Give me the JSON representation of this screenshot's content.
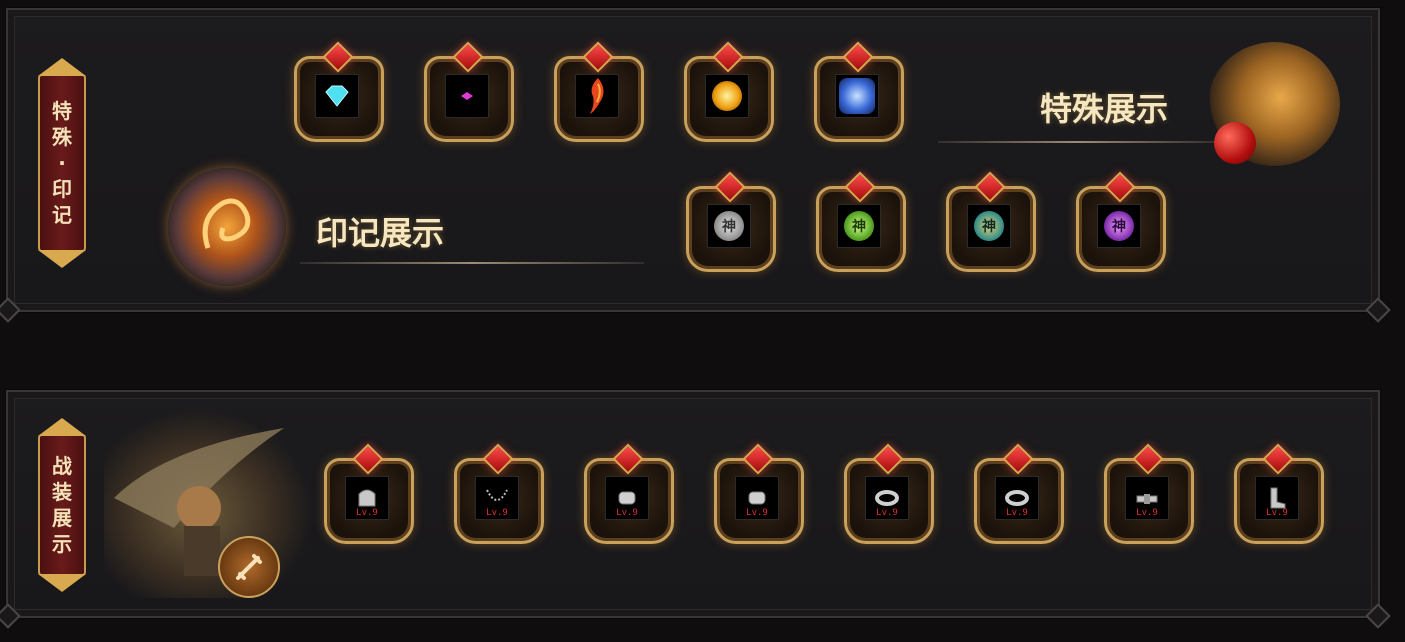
{
  "top_panel": {
    "badge_chars": [
      "特",
      "殊",
      "·",
      "印",
      "记"
    ],
    "special_title": "特殊展示",
    "seal_title": "印记展示",
    "special_items": [
      {
        "icon": "diamond-icon"
      },
      {
        "icon": "pink-gem-icon"
      },
      {
        "icon": "flame-feather-icon"
      },
      {
        "icon": "golden-orb-icon"
      },
      {
        "icon": "blue-rune-icon"
      }
    ],
    "seal_items": [
      {
        "icon": "silver-shen-seal-icon",
        "glyph": "神"
      },
      {
        "icon": "green-shen-seal-icon",
        "glyph": "神"
      },
      {
        "icon": "teal-shen-seal-icon",
        "glyph": "神"
      },
      {
        "icon": "purple-shen-seal-icon",
        "glyph": "神"
      }
    ]
  },
  "bottom_panel": {
    "badge_chars": [
      "战",
      "装",
      "展",
      "示"
    ],
    "equipment": [
      {
        "icon": "helmet-icon",
        "level": "Lv.9"
      },
      {
        "icon": "necklace-icon",
        "level": "Lv.9"
      },
      {
        "icon": "bracelet-icon",
        "level": "Lv.9"
      },
      {
        "icon": "bracelet-icon",
        "level": "Lv.9"
      },
      {
        "icon": "ring-icon",
        "level": "Lv.9"
      },
      {
        "icon": "ring-icon",
        "level": "Lv.9"
      },
      {
        "icon": "belt-icon",
        "level": "Lv.9"
      },
      {
        "icon": "boots-icon",
        "level": "Lv.9"
      }
    ]
  },
  "colors": {
    "gold": "#caa15a",
    "gem_red": "#d81f1f",
    "title_text": "#f6e7c1",
    "badge_bg": "#5a1414"
  }
}
